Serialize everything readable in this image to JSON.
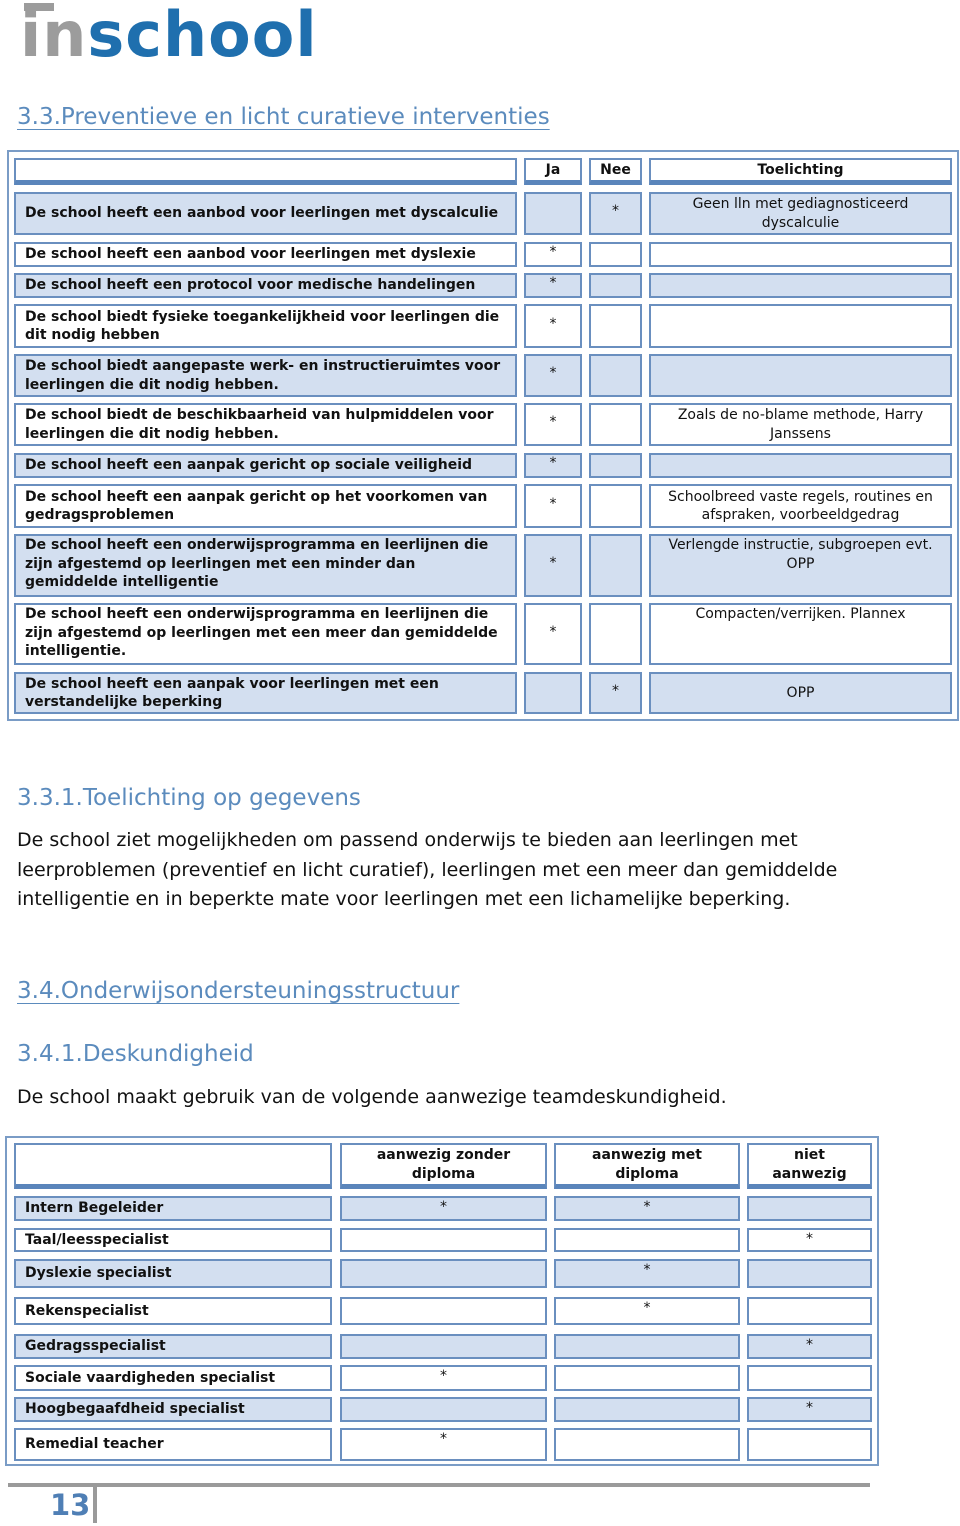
{
  "logo": {
    "part1": "in",
    "part2": "school"
  },
  "section_3_3": {
    "title": "3.3.Preventieve en licht curatieve interventies"
  },
  "interventions_table": {
    "headers": {
      "label": "",
      "ja": "Ja",
      "nee": "Nee",
      "toelichting": "Toelichting"
    },
    "rows": [
      {
        "label": "De school heeft een aanbod voor leerlingen met dyscalculie",
        "ja": "",
        "nee": "*",
        "toelichting": "Geen lln met gediagnosticeerd dyscalculie"
      },
      {
        "label": "De school heeft een aanbod voor leerlingen met dyslexie",
        "ja": "*",
        "nee": "",
        "toelichting": ""
      },
      {
        "label": "De school heeft een protocol voor medische handelingen",
        "ja": "*",
        "nee": "",
        "toelichting": ""
      },
      {
        "label": "De school biedt fysieke toegankelijkheid voor leerlingen die dit nodig hebben",
        "ja": "*",
        "nee": "",
        "toelichting": ""
      },
      {
        "label": "De school biedt aangepaste werk- en instructieruimtes voor leerlingen die dit nodig hebben.",
        "ja": "*",
        "nee": "",
        "toelichting": ""
      },
      {
        "label": "De school biedt de beschikbaarheid van hulpmiddelen voor leerlingen die dit nodig hebben.",
        "ja": "*",
        "nee": "",
        "toelichting": "Zoals de no-blame methode, Harry Janssens"
      },
      {
        "label": "De school heeft een aanpak gericht op sociale veiligheid",
        "ja": "*",
        "nee": "",
        "toelichting": ""
      },
      {
        "label": "De school heeft een aanpak gericht op het voorkomen van gedragsproblemen",
        "ja": "*",
        "nee": "",
        "toelichting": "Schoolbreed vaste regels, routines en afspraken, voorbeeldgedrag"
      },
      {
        "label": "De school heeft een onderwijsprogramma en leerlijnen die zijn afgestemd op leerlingen met een minder dan gemiddelde intelligentie",
        "ja": "*",
        "nee": "",
        "toelichting": "Verlengde instructie, subgroepen evt. OPP"
      },
      {
        "label": "De school heeft een onderwijsprogramma en leerlijnen die zijn afgestemd op leerlingen met een meer dan gemiddelde intelligentie.",
        "ja": "*",
        "nee": "",
        "toelichting": "Compacten/verrijken. Plannex"
      },
      {
        "label": "De school heeft een aanpak voor leerlingen met een verstandelijke beperking",
        "ja": "",
        "nee": "*",
        "toelichting": "OPP"
      }
    ]
  },
  "section_3_3_1": {
    "title": "3.3.1.Toelichting op gegevens",
    "paragraph": "De school ziet mogelijkheden om passend onderwijs te bieden aan leerlingen met leerproblemen (preventief en licht curatief), leerlingen met een meer dan gemiddelde intelligentie en in beperkte mate voor leerlingen met een lichamelijke beperking."
  },
  "section_3_4": {
    "title": "3.4.Onderwijsondersteuningsstructuur"
  },
  "section_3_4_1": {
    "title": "3.4.1.Deskundigheid",
    "paragraph": "De school maakt gebruik van de volgende aanwezige teamdeskundigheid."
  },
  "expertise_table": {
    "headers": {
      "label": "",
      "zonder": "aanwezig zonder diploma",
      "met": "aanwezig met diploma",
      "niet": "niet aanwezig"
    },
    "rows": [
      {
        "label": "Intern Begeleider",
        "zonder": "*",
        "met": "*",
        "niet": ""
      },
      {
        "label": "Taal/leesspecialist",
        "zonder": "",
        "met": "",
        "niet": "*"
      },
      {
        "label": "Dyslexie specialist",
        "zonder": "",
        "met": "*",
        "niet": ""
      },
      {
        "label": "Rekenspecialist",
        "zonder": "",
        "met": "*",
        "niet": ""
      },
      {
        "label": "Gedragsspecialist",
        "zonder": "",
        "met": "",
        "niet": "*"
      },
      {
        "label": "Sociale vaardigheden specialist",
        "zonder": "*",
        "met": "",
        "niet": ""
      },
      {
        "label": "Hoogbegaafdheid specialist",
        "zonder": "",
        "met": "",
        "niet": "*"
      },
      {
        "label": "Remedial teacher",
        "zonder": "*",
        "met": "",
        "niet": ""
      }
    ]
  },
  "footer": {
    "page_number": "13"
  },
  "colors": {
    "heading": "#5b8bbd",
    "row_blue": "#d3dff0",
    "border": "#6a8fbf",
    "logo_gray": "#9c9c9c",
    "logo_blue": "#1f6fae"
  }
}
